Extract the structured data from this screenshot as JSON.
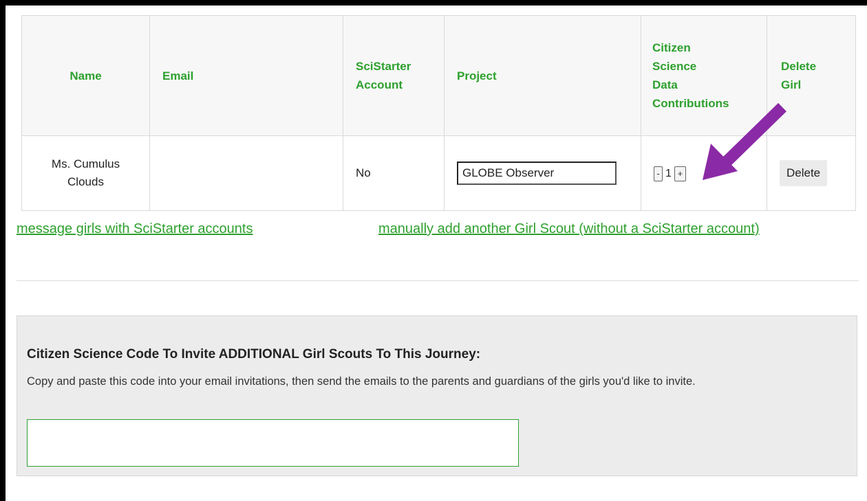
{
  "table": {
    "headers": {
      "name": "Name",
      "email": "Email",
      "account": [
        "SciStarter",
        "Account"
      ],
      "project": "Project",
      "contributions": [
        "Citizen",
        "Science",
        "Data",
        "Contributions"
      ],
      "delete": [
        "Delete",
        "Girl"
      ]
    },
    "rows": [
      {
        "name": [
          "Ms. Cumulus",
          "Clouds"
        ],
        "email": "",
        "account": "No",
        "project": "GLOBE Observer",
        "decrement": "-",
        "count": "1",
        "increment": "+",
        "delete_label": "Delete"
      }
    ]
  },
  "links": {
    "message": "message girls with SciStarter accounts",
    "add_girl": "manually add another Girl Scout (without a SciStarter account)"
  },
  "invite": {
    "title": "Citizen Science Code To Invite ADDITIONAL Girl Scouts To This Journey:",
    "description": "Copy and paste this code into your email invitations, then send the emails to the parents and guardians of the girls you'd like to invite.",
    "code_value": ""
  },
  "colors": {
    "accent_green": "#2ea02e",
    "annotation_arrow": "#8b2aa6"
  },
  "annotation": {
    "icon": "arrow-pointing-to-plus-button"
  }
}
